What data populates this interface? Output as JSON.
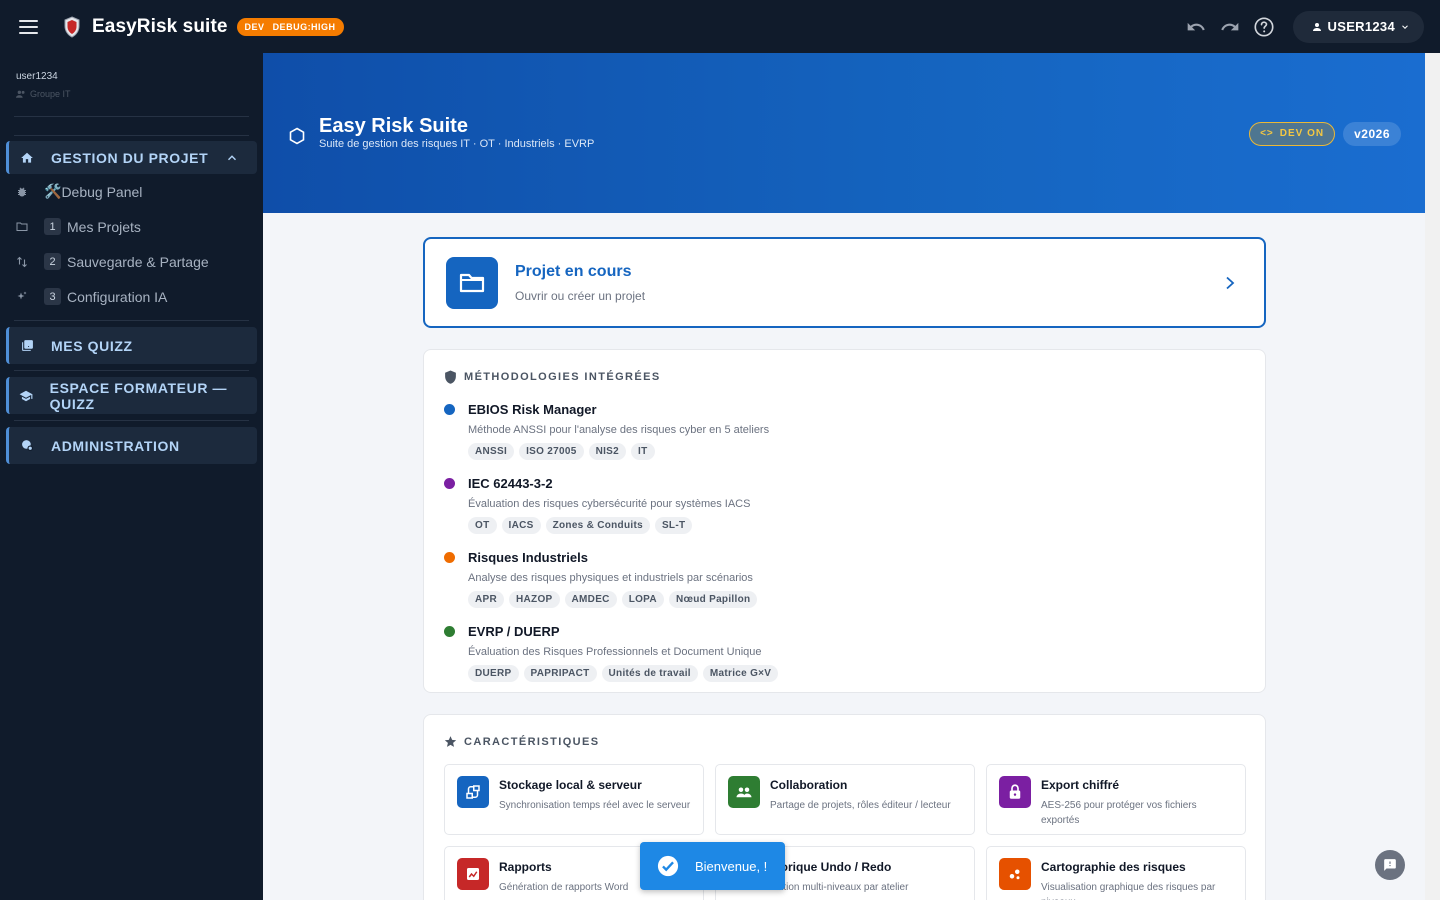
{
  "topbar": {
    "app_title": "EasyRisk suite",
    "env_badge_a": "DEV",
    "env_badge_b": "DEBUG:HIGH",
    "user_button": "USER1234"
  },
  "sidebar": {
    "user_name": "user1234",
    "user_dept": "Groupe IT",
    "sections": [
      {
        "label": "GESTION DU PROJET",
        "icon": "home-icon"
      },
      {
        "label": "MES QUIZZ",
        "icon": "quiz-icon"
      },
      {
        "label": "ESPACE FORMATEUR — QUIZZ",
        "icon": "school-icon"
      },
      {
        "label": "ADMINISTRATION",
        "icon": "admin-icon"
      }
    ],
    "items": [
      {
        "label": "Debug Panel",
        "emoji": "🛠️",
        "icon": "bug-icon"
      },
      {
        "label": "Mes Projets",
        "num": "1",
        "icon": "folder-icon"
      },
      {
        "label": "Sauvegarde & Partage",
        "num": "2",
        "icon": "sync-icon"
      },
      {
        "label": "Configuration IA",
        "num": "3",
        "icon": "sparkle-icon"
      }
    ]
  },
  "hero": {
    "title": "Easy Risk Suite",
    "subtitle": "Suite de gestion des risques IT · OT · Industriels · EVRP",
    "dev_badge": "DEV ON",
    "version": "v2026"
  },
  "project": {
    "title": "Projet en cours",
    "subtitle": "Ouvrir ou créer un projet"
  },
  "methodologies": {
    "heading": "MÉTHODOLOGIES INTÉGRÉES",
    "items": [
      {
        "name": "EBIOS Risk Manager",
        "desc": "Méthode ANSSI pour l'analyse des risques cyber en 5 ateliers",
        "color": "#1565c0",
        "tags": [
          "ANSSI",
          "ISO 27005",
          "NIS2",
          "IT"
        ]
      },
      {
        "name": "IEC 62443-3-2",
        "desc": "Évaluation des risques cybersécurité pour systèmes IACS",
        "color": "#7b1fa2",
        "tags": [
          "OT",
          "IACS",
          "Zones & Conduits",
          "SL-T"
        ]
      },
      {
        "name": "Risques Industriels",
        "desc": "Analyse des risques physiques et industriels par scénarios",
        "color": "#ef6c00",
        "tags": [
          "APR",
          "HAZOP",
          "AMDEC",
          "LOPA",
          "Nœud Papillon"
        ]
      },
      {
        "name": "EVRP / DUERP",
        "desc": "Évaluation des Risques Professionnels et Document Unique",
        "color": "#2e7d32",
        "tags": [
          "DUERP",
          "PAPRIPACT",
          "Unités de travail",
          "Matrice G×V"
        ]
      }
    ]
  },
  "features": {
    "heading": "CARACTÉRISTIQUES",
    "items": [
      {
        "title": "Stockage local & serveur",
        "desc": "Synchronisation temps réel avec le serveur",
        "color": "#1565c0",
        "icon": "storage-icon"
      },
      {
        "title": "Collaboration",
        "desc": "Partage de projets, rôles éditeur / lecteur",
        "color": "#2e7d32",
        "icon": "group-icon"
      },
      {
        "title": "Export chiffré",
        "desc": "AES-256 pour protéger vos fichiers exportés",
        "color": "#7b1fa2",
        "icon": "lock-icon"
      },
      {
        "title": "Rapports",
        "desc": "Génération de rapports Word",
        "color": "#c62828",
        "icon": "report-icon"
      },
      {
        "title": "storique Undo / Redo",
        "desc": "ulation multi-niveaux par atelier",
        "color": "#00838f",
        "icon": "history-icon"
      },
      {
        "title": "Cartographie des risques",
        "desc": "Visualisation graphique des risques par niveaux",
        "color": "#e65100",
        "icon": "map-icon"
      }
    ]
  },
  "toast": {
    "text": "Bienvenue, !"
  }
}
